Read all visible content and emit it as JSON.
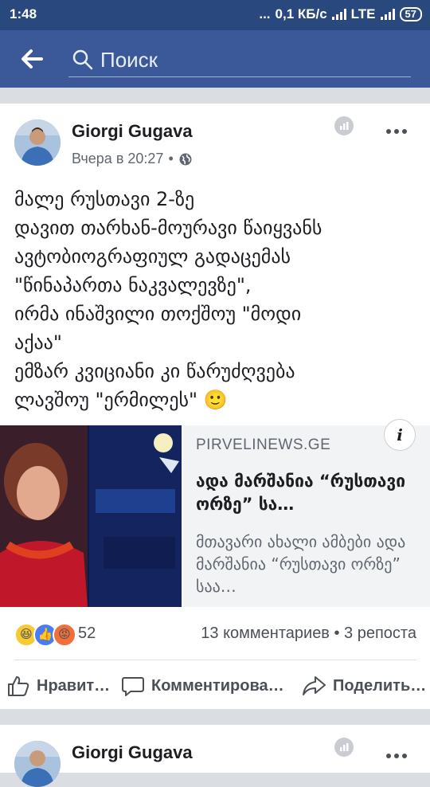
{
  "status_bar": {
    "time": "1:48",
    "dots": "...",
    "net_speed": "0,1 КБ/с",
    "network": "LTE",
    "battery": "57"
  },
  "search": {
    "placeholder": "Поиск"
  },
  "post": {
    "author": "Giorgi Gugava",
    "timestamp": "Вчера в 20:27",
    "separator": "•",
    "text": "მალე რუსთავი 2-ზე\nდავით თარხან-მოურავი წაიყვანს\nავტობიოგრაფიულ გადაცემას\n\"წინაპართა ნაკვალევზე\",\nირმა ინაშვილი თოქშოუ \"მოდი\nაქაა\"\nემზარ კვიციანი კი წარუძღვება\nლავშოუ \"ერმილეს\" 🙂",
    "link": {
      "domain": "PIRVELINEWS.GE",
      "title": "ადა მარშანია “რუსთავი ორზე” სა…",
      "description": "მთავარი ახალი ამბები ადა მარშანია “რუსთავი ორზე” საა…",
      "info_label": "i"
    },
    "reactions_count": "52",
    "comments_shares": "13 комментариев • 3 репоста",
    "actions": {
      "like": "Нравит…",
      "comment": "Комментирова…",
      "share": "Поделить…"
    }
  },
  "next_post": {
    "author": "Giorgi Gugava"
  },
  "colors": {
    "header": "#3b5998",
    "status_bar": "#29487d",
    "background": "#dadde1"
  }
}
